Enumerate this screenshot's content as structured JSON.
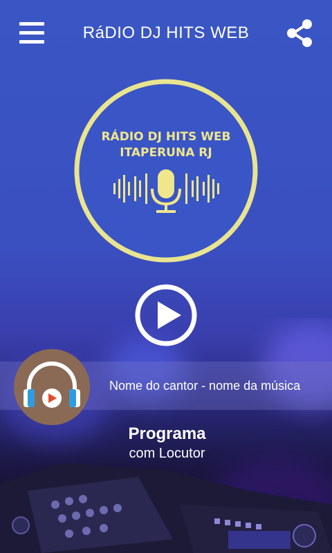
{
  "header": {
    "title": "RáDIO DJ HITS WEB",
    "menu_icon": "hamburger-menu-icon",
    "share_icon": "share-icon"
  },
  "logo": {
    "line1": "RÁDIO DJ HITS WEB",
    "line2": "ITAPERUNA RJ",
    "icon": "microphone-icon",
    "ring_color": "#e9e48f",
    "text_color": "#f0e68c"
  },
  "player": {
    "play_icon": "play-icon",
    "now_playing": "Nome do cantor - nome da música",
    "avatar_icon": "headphones-icon"
  },
  "program": {
    "title": "Programa",
    "host": "com Locutor"
  },
  "colors": {
    "background": "#3a56c4",
    "avatar_bg": "#8a6a55",
    "headphone_blue": "#2f9be0",
    "play_red": "#e8492a"
  }
}
